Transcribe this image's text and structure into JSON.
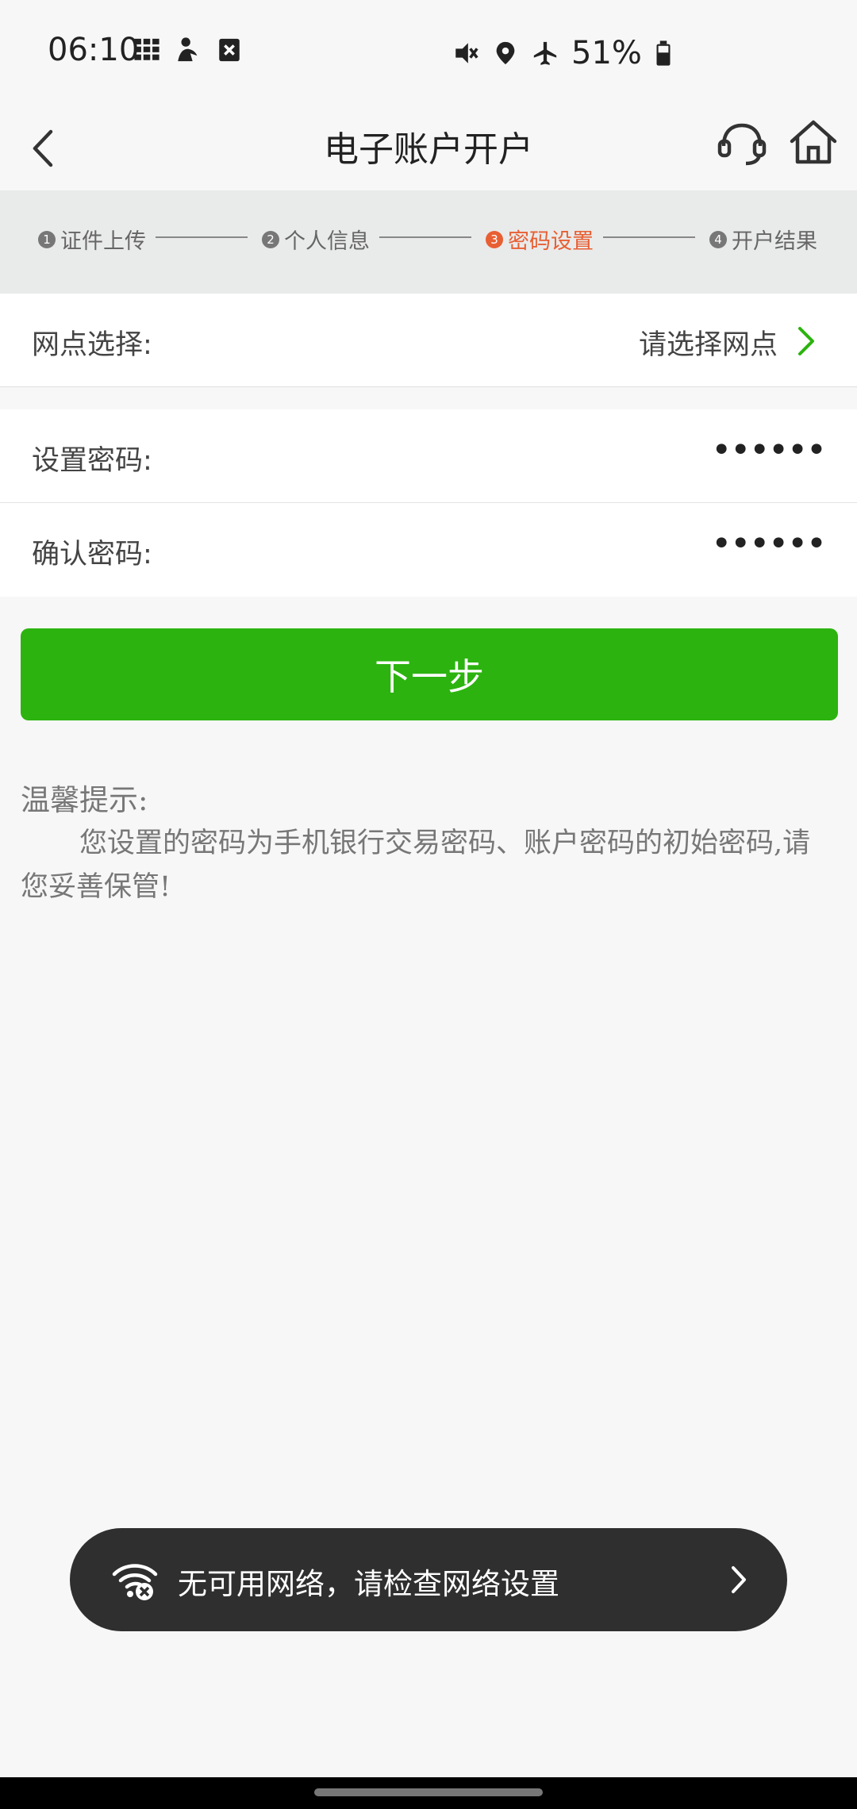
{
  "status_bar": {
    "time": "06:10",
    "battery": "51%",
    "left_icons": [
      "grid-icon",
      "person-icon",
      "close-box-icon"
    ],
    "right_icons": [
      "vibrate-mute-icon",
      "location-icon",
      "airplane-icon",
      "battery-icon"
    ]
  },
  "header": {
    "title": "电子账户开户",
    "back_icon": "back-arrow-icon",
    "service_icon": "headset-icon",
    "home_icon": "home-icon"
  },
  "steps": [
    {
      "num": "1",
      "label": "证件上传",
      "active": false
    },
    {
      "num": "2",
      "label": "个人信息",
      "active": false
    },
    {
      "num": "3",
      "label": "密码设置",
      "active": true
    },
    {
      "num": "4",
      "label": "开户结果",
      "active": false
    }
  ],
  "form": {
    "branch_label": "网点选择:",
    "branch_placeholder": "请选择网点",
    "password_label": "设置密码:",
    "password_value": "••••••",
    "confirm_label": "确认密码:",
    "confirm_value": "••••••"
  },
  "next_button": "下一步",
  "tips": {
    "title": "温馨提示:",
    "body": "您设置的密码为手机银行交易密码、账户密码的初始密码,请您妥善保管!"
  },
  "toast": {
    "text": "无可用网络，请检查网络设置"
  },
  "colors": {
    "accent_green": "#2cb30f",
    "active_step": "#e85f33"
  }
}
